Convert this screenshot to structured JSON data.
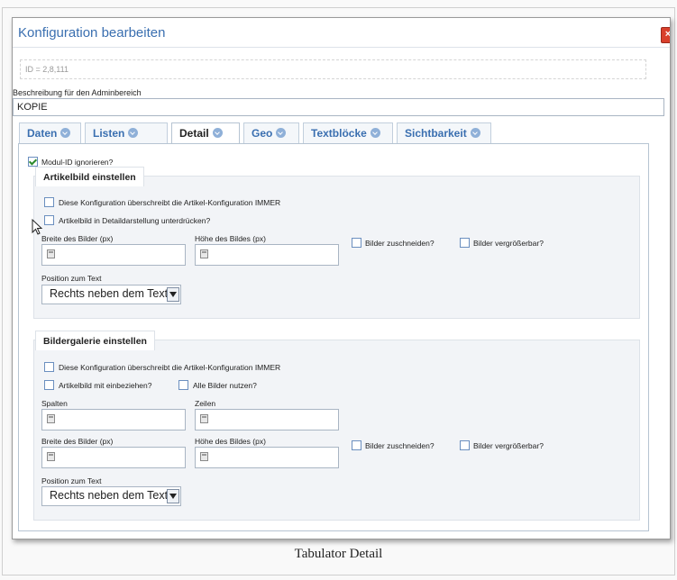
{
  "dialog": {
    "title": "Konfiguration bearbeiten",
    "close_label": "×",
    "id_text": "ID = 2,8,111",
    "description_label": "Beschreibung für den Adminbereich",
    "description_value": "KOPIE"
  },
  "tabs": [
    {
      "label": "Daten"
    },
    {
      "label": "Listen"
    },
    {
      "label": "Detail"
    },
    {
      "label": "Geo"
    },
    {
      "label": "Textblöcke"
    },
    {
      "label": "Sichtbarkeit"
    }
  ],
  "active_tab": "Detail",
  "panel": {
    "modul_id": {
      "label": "Modul-ID ignorieren?",
      "checked": true
    },
    "artikelbild": {
      "legend": "Artikelbild einstellen",
      "override": {
        "label": "Diese Konfiguration überschreibt die Artikel-Konfiguration IMMER",
        "checked": false
      },
      "suppress": {
        "label": "Artikelbild in Detaildarstellung unterdrücken?",
        "checked": false
      },
      "width_label": "Breite des Bilder (px)",
      "height_label": "Höhe des Bildes (px)",
      "crop": {
        "label": "Bilder zuschneiden?",
        "checked": false
      },
      "zoom": {
        "label": "Bilder vergrößerbar?",
        "checked": false
      },
      "position_label": "Position zum Text",
      "position_value": "Rechts neben dem Text"
    },
    "galerie": {
      "legend": "Bildergalerie einstellen",
      "override": {
        "label": "Diese Konfiguration überschreibt die Artikel-Konfiguration IMMER",
        "checked": false
      },
      "include": {
        "label": "Artikelbild mit einbeziehen?",
        "checked": false
      },
      "all": {
        "label": "Alle Bilder nutzen?",
        "checked": false
      },
      "columns_label": "Spalten",
      "rows_label": "Zeilen",
      "width_label": "Breite des Bilder (px)",
      "height_label": "Höhe des Bildes (px)",
      "crop": {
        "label": "Bilder zuschneiden?",
        "checked": false
      },
      "zoom": {
        "label": "Bilder vergrößerbar?",
        "checked": false
      },
      "position_label": "Position zum Text",
      "position_value": "Rechts neben dem Text"
    }
  },
  "caption": "Tabulator Detail",
  "colors": {
    "accent": "#3a6fb0",
    "close": "#d9402c",
    "fieldset_bg": "#f2f4f7"
  },
  "icons": [
    "close-icon",
    "help-icon",
    "calculator-icon",
    "dropdown-arrow-icon",
    "mouse-cursor-icon",
    "check-icon"
  ]
}
